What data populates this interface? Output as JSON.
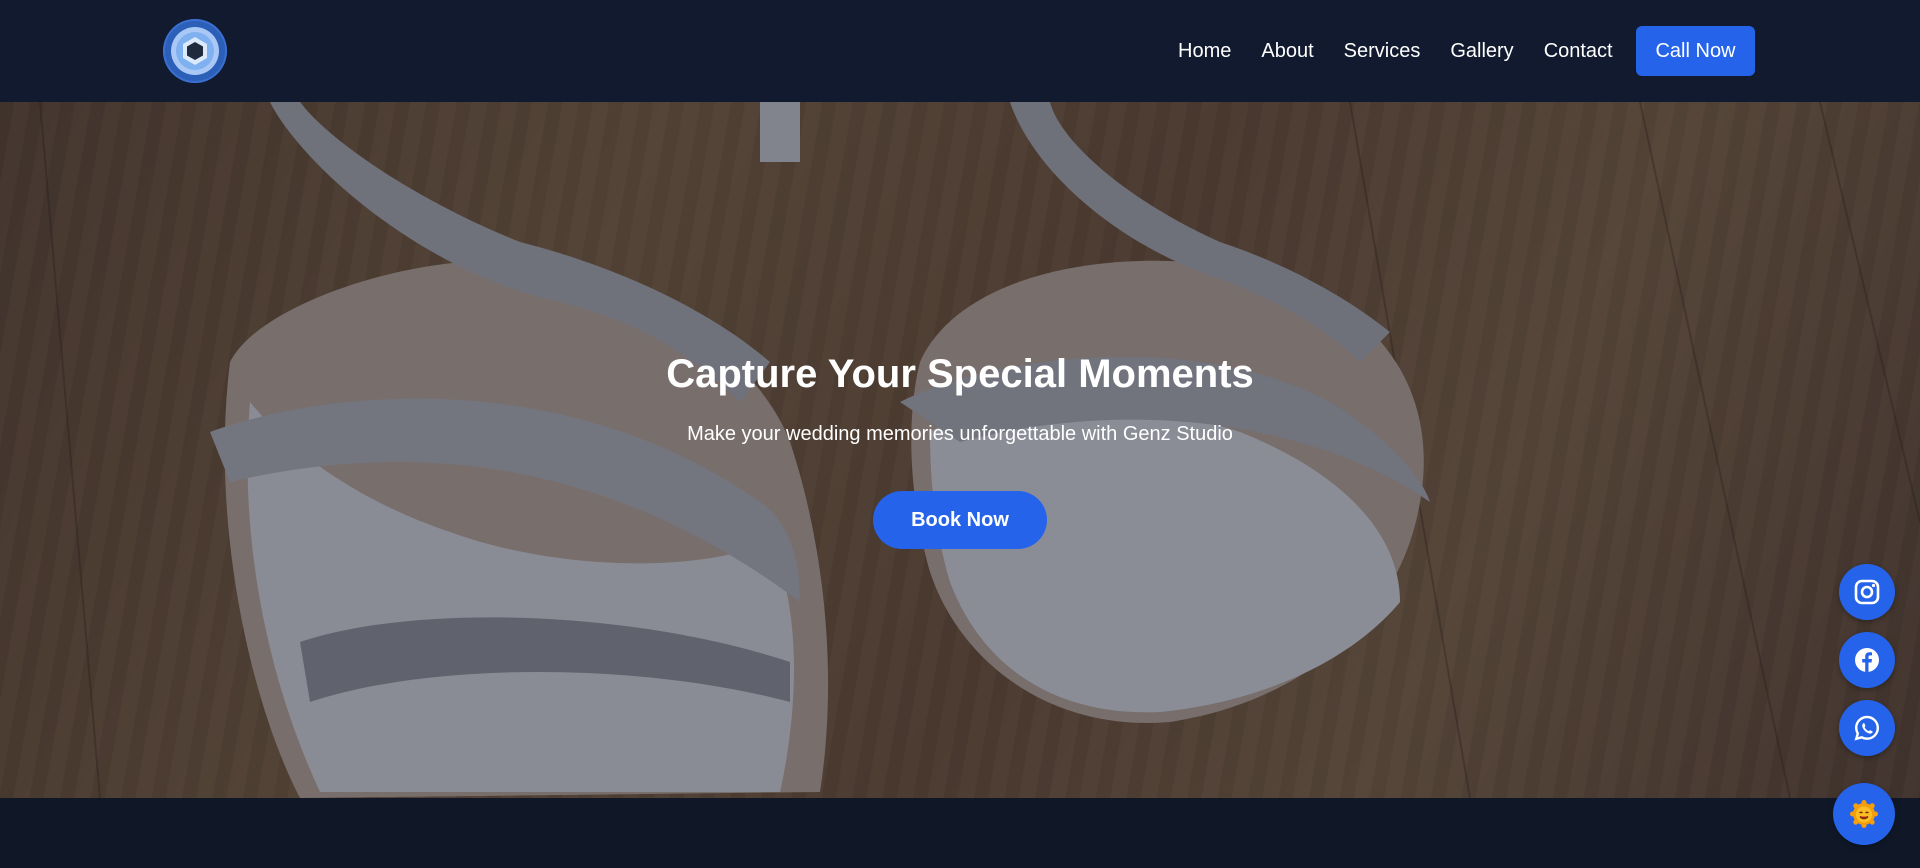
{
  "header": {
    "logo_icon": "camera-aperture-icon",
    "nav": [
      {
        "label": "Home"
      },
      {
        "label": "About"
      },
      {
        "label": "Services"
      },
      {
        "label": "Gallery"
      },
      {
        "label": "Contact"
      }
    ],
    "call_label": "Call Now"
  },
  "hero": {
    "title": "Capture Your Special Moments",
    "subtitle": "Make your wedding memories unforgettable with Genz Studio",
    "book_label": "Book Now",
    "background": "wedding-shoes-photo"
  },
  "floating": {
    "socials": [
      "instagram-icon",
      "facebook-icon",
      "whatsapp-icon"
    ],
    "chat_icon": "smiley-chat-icon"
  },
  "colors": {
    "header_bg": "#111a2e",
    "accent": "#2563eb",
    "page_bg": "#101828"
  }
}
